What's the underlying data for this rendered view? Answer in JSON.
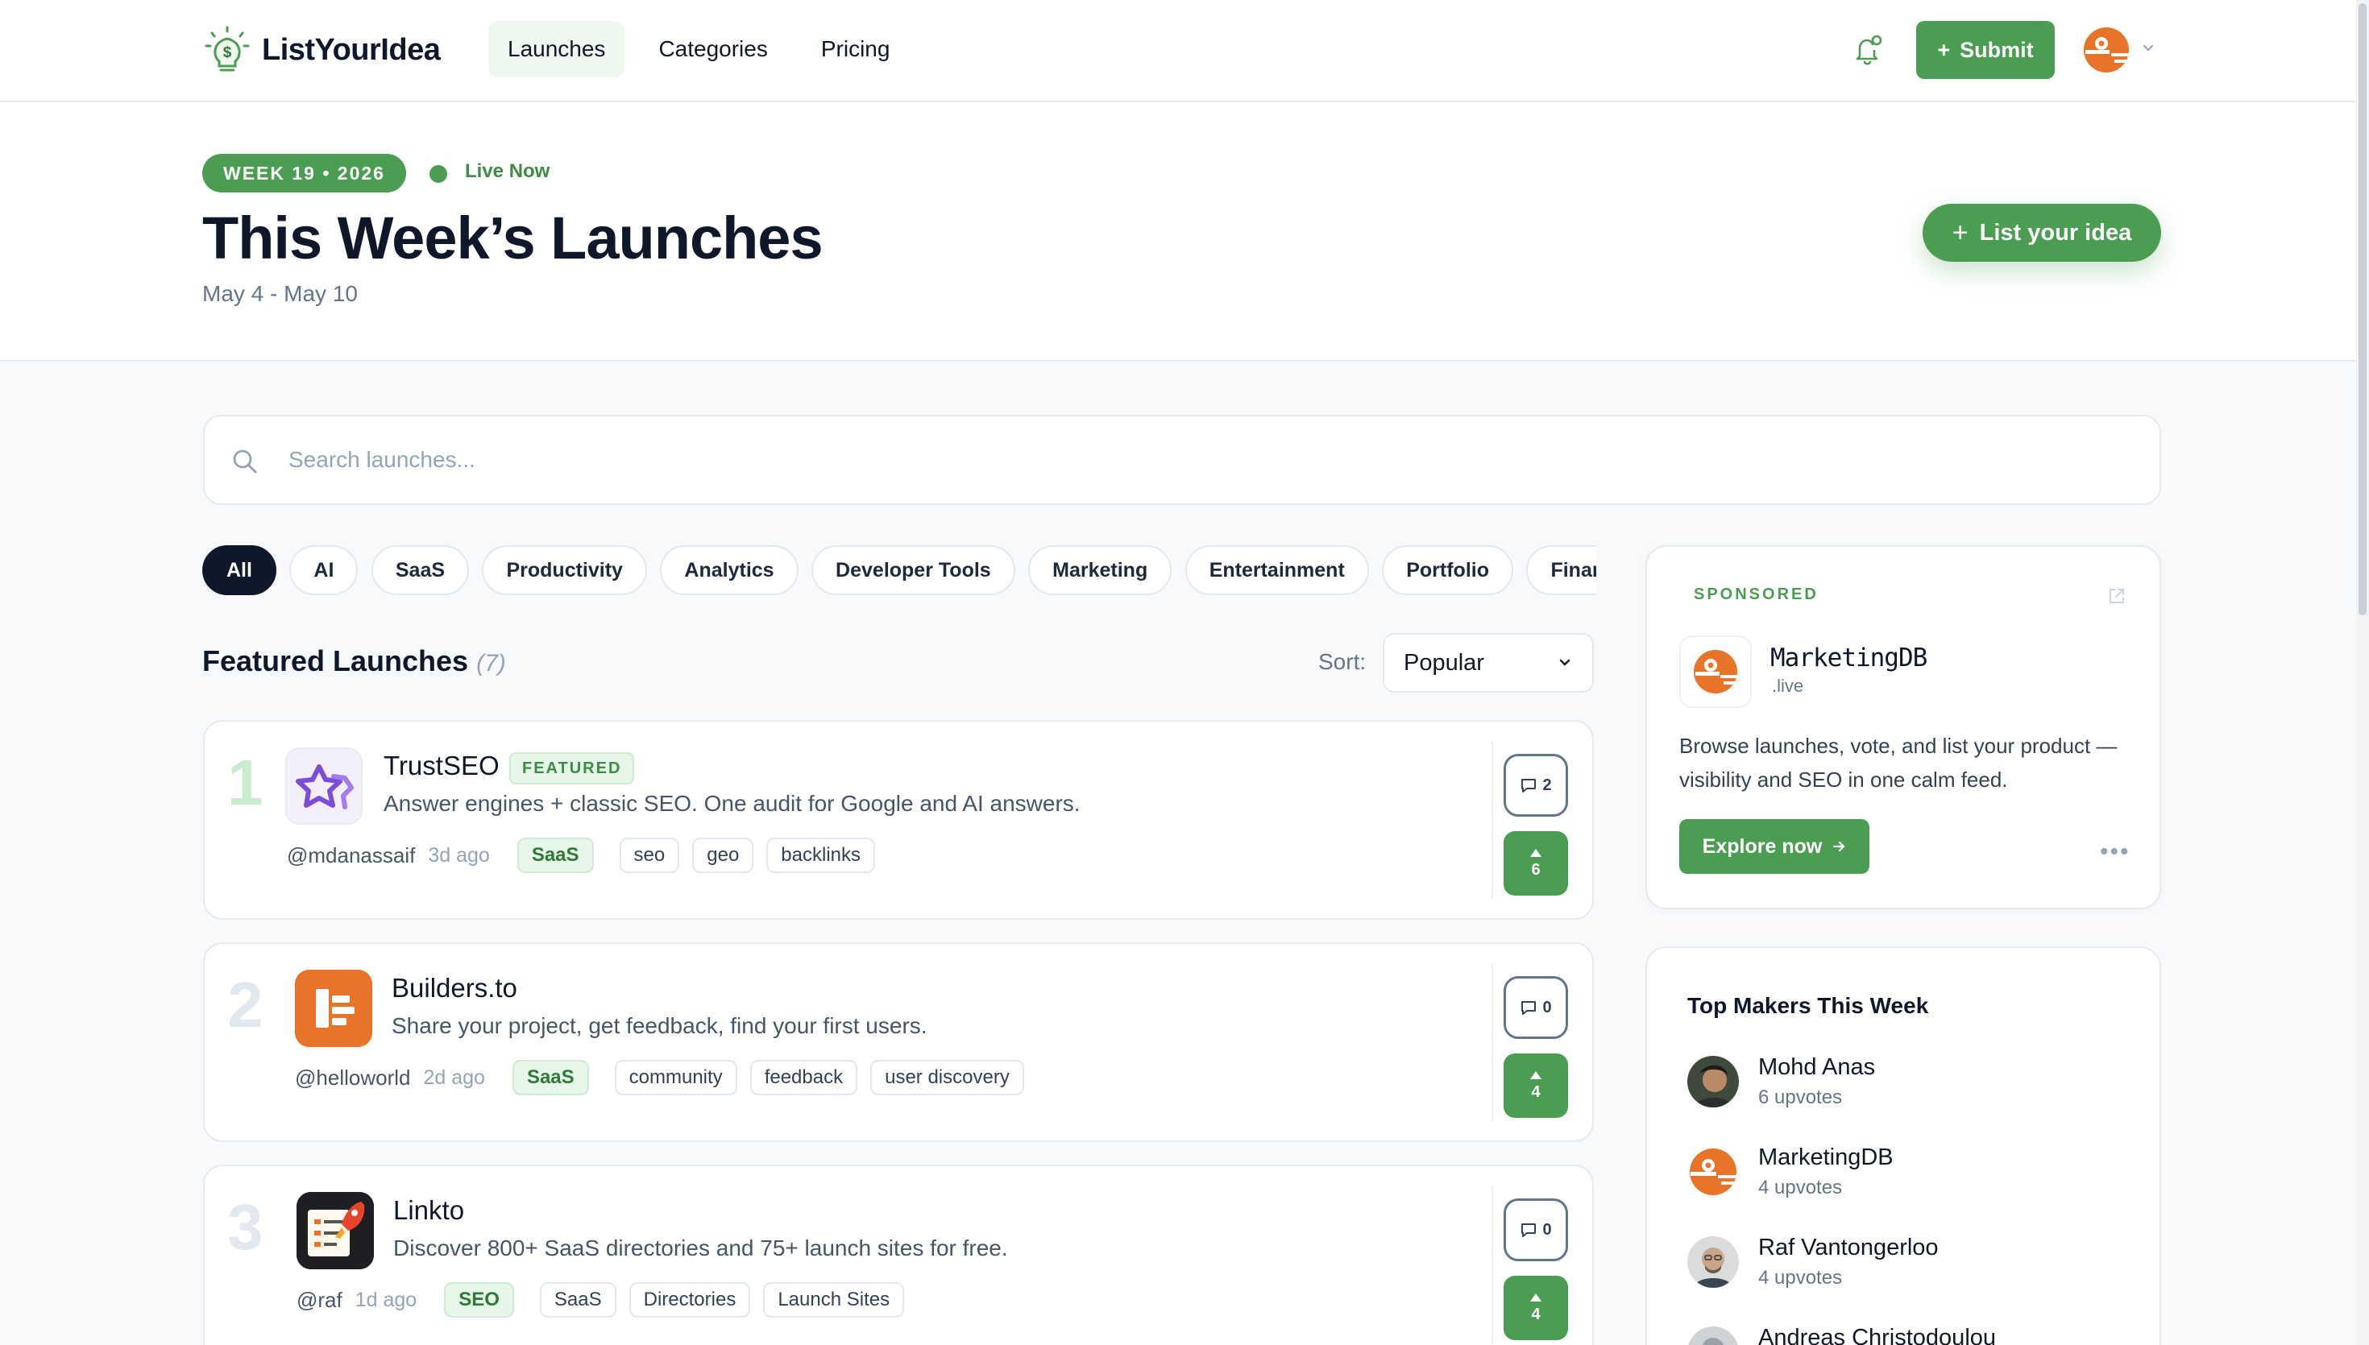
{
  "brand": {
    "name": "ListYourIdea"
  },
  "nav": [
    {
      "label": "Launches",
      "active": true
    },
    {
      "label": "Categories"
    },
    {
      "label": "Pricing"
    }
  ],
  "header": {
    "submit_label": "Submit"
  },
  "hero": {
    "week_badge": "WEEK 19 • 2026",
    "live_label": "Live Now",
    "title": "This Week’s Launches",
    "dates": "May 4 - May 10",
    "cta_label": "List your idea"
  },
  "search": {
    "placeholder": "Search launches..."
  },
  "categories": [
    "All",
    "AI",
    "SaaS",
    "Productivity",
    "Analytics",
    "Developer Tools",
    "Marketing",
    "Entertainment",
    "Portfolio",
    "Finance"
  ],
  "featured": {
    "title": "Featured Launches",
    "count": "(7)",
    "sort_label": "Sort:",
    "sort_value": "Popular"
  },
  "launches": [
    {
      "rank": "1",
      "name": "TrustSEO",
      "badge": "FEATURED",
      "description": "Answer engines + classic SEO. One audit for Google and AI answers.",
      "maker": "@mdanassaif",
      "ago": "3d ago",
      "category": "SaaS",
      "tags": [
        "seo",
        "geo",
        "backlinks"
      ],
      "comments": "2",
      "votes": "6"
    },
    {
      "rank": "2",
      "name": "Builders.to",
      "description": "Share your project, get feedback, find your first users.",
      "maker": "@helloworld",
      "ago": "2d ago",
      "category": "SaaS",
      "tags": [
        "community",
        "feedback",
        "user discovery"
      ],
      "comments": "0",
      "votes": "4"
    },
    {
      "rank": "3",
      "name": "Linkto",
      "description": "Discover 800+ SaaS directories and 75+ launch sites for free.",
      "maker": "@raf",
      "ago": "1d ago",
      "category": "SEO",
      "tags": [
        "SaaS",
        "Directories",
        "Launch Sites"
      ],
      "comments": "0",
      "votes": "4"
    }
  ],
  "sponsored": {
    "label": "SPONSORED",
    "name": "MarketingDB",
    "sub": ".live",
    "description": "Browse launches, vote, and list your product — visibility and SEO in one calm feed.",
    "cta": "Explore now"
  },
  "top_makers": {
    "title": "Top Makers This Week",
    "items": [
      {
        "name": "Mohd Anas",
        "votes": "6 upvotes"
      },
      {
        "name": "MarketingDB",
        "votes": "4 upvotes"
      },
      {
        "name": "Raf Vantongerloo",
        "votes": "4 upvotes"
      },
      {
        "name": "Andreas Christodoulou",
        "votes": ""
      }
    ]
  },
  "colors": {
    "accent": "#4a9d51",
    "ink": "#0f172a",
    "muted": "#64748b",
    "brand_orange": "#e8742a"
  },
  "icons": {
    "brand": "lightbulb-dollar-icon",
    "bell": "bell-icon",
    "search": "search-icon",
    "comment": "comment-icon",
    "vote": "upvote-arrow-icon",
    "external": "external-link-icon",
    "more": "more-horizontal-icon"
  }
}
